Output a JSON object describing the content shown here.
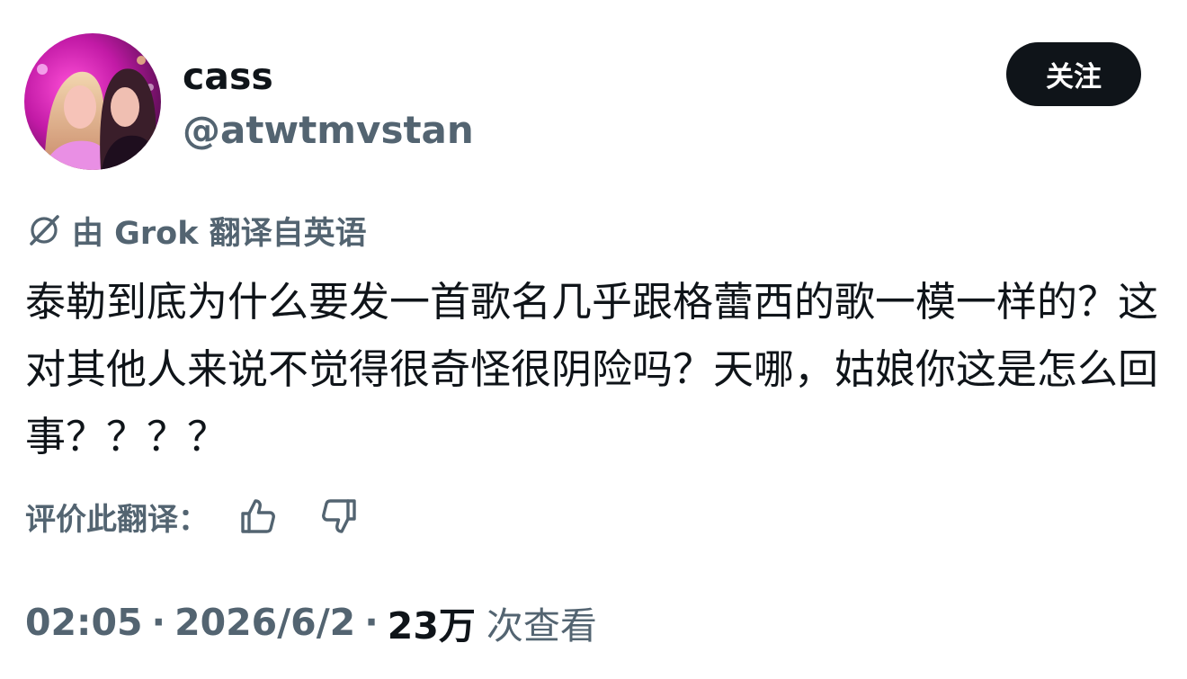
{
  "author": {
    "display_name": "cass",
    "handle": "@atwtmvstan"
  },
  "follow_button": {
    "label": "关注"
  },
  "translation": {
    "notice": "由 Grok 翻译自英语",
    "icon": "grok-icon"
  },
  "tweet": {
    "text": "泰勒到底为什么要发一首歌名几乎跟格蕾西的歌一模一样的？这对其他人来说不觉得很奇怪很阴险吗？天哪，姑娘你这是怎么回事？？？？"
  },
  "rating": {
    "label": "评价此翻译：",
    "thumbs_up_icon": "thumbs-up-icon",
    "thumbs_down_icon": "thumbs-down-icon"
  },
  "meta": {
    "time": "02:05",
    "separator": "·",
    "date": "2026/6/2",
    "views_count": "23万",
    "views_label": "次查看"
  },
  "colors": {
    "text_primary": "#0f1419",
    "text_secondary": "#536471",
    "button_bg": "#0f1419",
    "button_text": "#ffffff"
  }
}
